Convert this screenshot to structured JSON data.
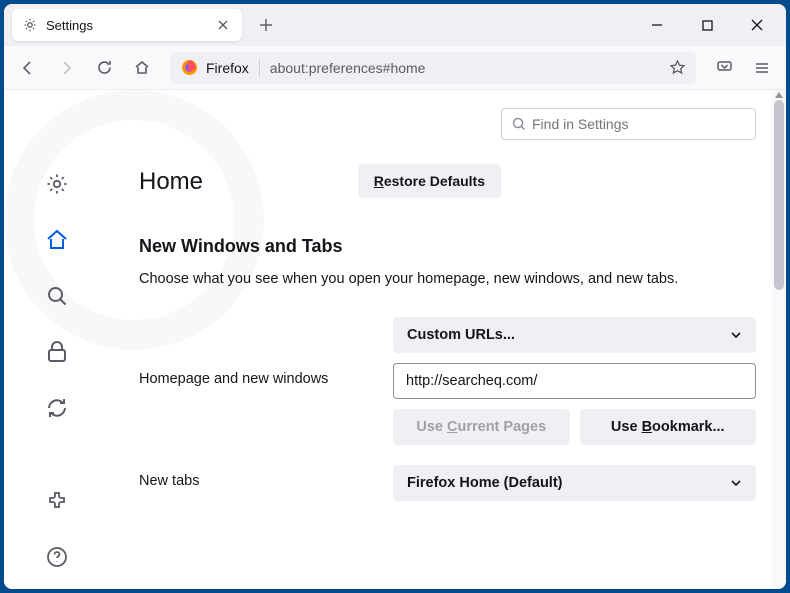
{
  "tab": {
    "title": "Settings"
  },
  "url": {
    "prefix": "Firefox",
    "path": "about:preferences#home"
  },
  "search": {
    "placeholder": "Find in Settings"
  },
  "page": {
    "title": "Home",
    "restore_label": "Restore Defaults"
  },
  "section": {
    "title": "New Windows and Tabs",
    "desc": "Choose what you see when you open your homepage, new windows, and new tabs."
  },
  "homepage": {
    "label": "Homepage and new windows",
    "select_value": "Custom URLs...",
    "url_value": "http://searcheq.com/",
    "use_current": "Use Current Pages",
    "use_bookmark": "Use Bookmark..."
  },
  "newtabs": {
    "label": "New tabs",
    "select_value": "Firefox Home (Default)"
  }
}
